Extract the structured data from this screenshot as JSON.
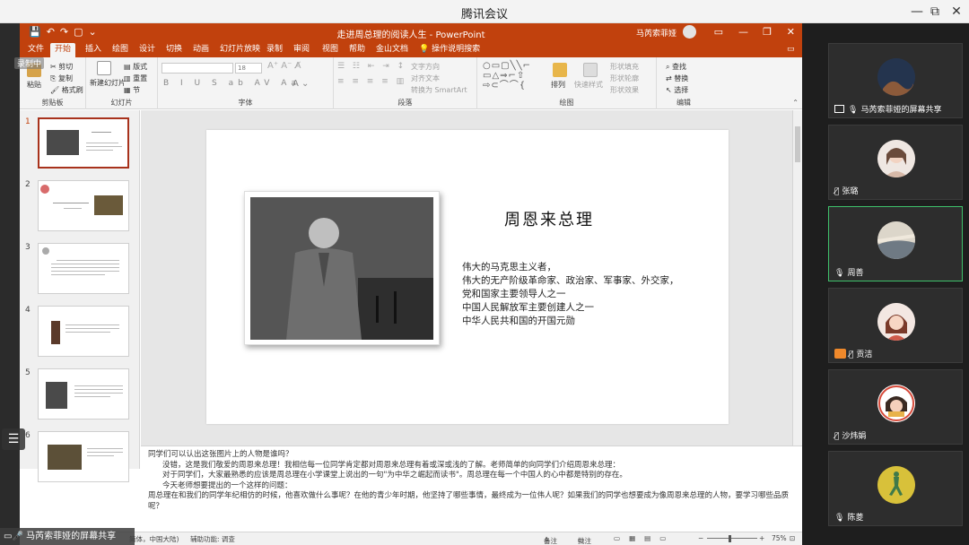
{
  "window": {
    "title": "腾讯会议",
    "controls": [
      "—",
      "⧉",
      "✕"
    ]
  },
  "ppt": {
    "doc_title": "走进周总理的阅读人生 - PowerPoint",
    "user": "马芮索菲娅",
    "tabs": [
      {
        "label": "文件"
      },
      {
        "label": "开始",
        "active": true
      },
      {
        "label": "插入"
      },
      {
        "label": "绘图"
      },
      {
        "label": "设计"
      },
      {
        "label": "切换"
      },
      {
        "label": "动画"
      },
      {
        "label": "幻灯片放映"
      },
      {
        "label": "录制"
      },
      {
        "label": "审阅"
      },
      {
        "label": "视图"
      },
      {
        "label": "帮助"
      },
      {
        "label": "金山文档"
      },
      {
        "label": "操作说明搜索"
      }
    ],
    "ribbon": {
      "clipboard": {
        "paste": "粘贴",
        "cut": "剪切",
        "copy": "复制",
        "format_painter": "格式刷",
        "label": "剪贴板"
      },
      "slides": {
        "new_slide": "新建幻灯片",
        "layout": "版式",
        "reset": "重置",
        "section": "节",
        "label": "幻灯片"
      },
      "font": {
        "font_size": "18",
        "label": "字体"
      },
      "paragraph": {
        "text_direction": "文字方向",
        "align_text": "对齐文本",
        "smartart": "转换为 SmartArt",
        "label": "段落"
      },
      "drawing": {
        "arrange": "排列",
        "quick_styles": "快速样式",
        "shape_fill": "形状填充",
        "shape_outline": "形状轮廓",
        "shape_effects": "形状效果",
        "label": "绘图"
      },
      "editing": {
        "find": "查找",
        "replace": "替换",
        "select": "选择",
        "label": "编辑"
      }
    },
    "thumbnails": [
      "1",
      "2",
      "3",
      "4",
      "5",
      "6"
    ],
    "slide": {
      "title": "周恩来总理",
      "lines": [
        "伟大的马克思主义者，",
        "伟大的无产阶级革命家、政治家、军事家、外交家，",
        "党和国家主要领导人之一",
        "中国人民解放军主要创建人之一",
        "中华人民共和国的开国元勋"
      ]
    },
    "notes": {
      "line1": "同学们可以认出这张图片上的人物是谁吗？",
      "line2": "没错，这是我们敬爱的周恩来总理！我相信每一位同学肯定都对周恩来总理有着或深或浅的了解。老师简单的向同学们介绍周恩来总理：",
      "line3": "对于同学们，大家最熟悉的应该是周总理在小学课堂上说出的一句\"为中华之崛起而读书\"。周总理在每一个中国人的心中都是特别的存在。",
      "line4": "今天老师想要提出的一个这样的问题：",
      "line5": "周总理在和我们的同学年纪相仿的时候，他喜欢做什么事呢？在他的青少年时期，他坚持了哪些事情，最终成为一位伟人呢？如果我们的同学也想要成为像周恩来总理的人物，要学习哪些品质呢？"
    },
    "status": {
      "language": "简体，中国大陆)",
      "accessibility": "辅助功能: 调查",
      "notes_btn": "备注",
      "comments_btn": "批注",
      "zoom": "75%"
    }
  },
  "overlay": {
    "share_label": "马芮索菲娅的屏幕共享",
    "cloud": "录制中"
  },
  "participants": [
    {
      "name": "马芮索菲娅的屏幕共享",
      "type": "screen"
    },
    {
      "name": "张璐",
      "type": "muted"
    },
    {
      "name": "周善",
      "type": "mic",
      "active": true
    },
    {
      "name": "贡洁",
      "type": "muted-badge"
    },
    {
      "name": "沙炜娟",
      "type": "muted"
    },
    {
      "name": "陈菱",
      "type": "mic"
    }
  ],
  "colors": {
    "ppt_accent": "#c1410d",
    "active_speaker": "#3fc16b",
    "panel_bg": "#1e1e1e"
  }
}
